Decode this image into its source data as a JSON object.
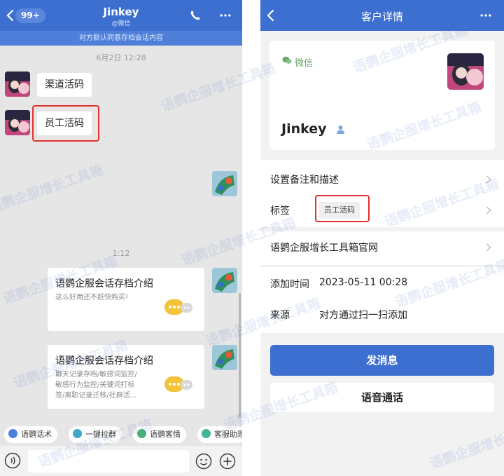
{
  "chat": {
    "unread_badge": "99+",
    "title": "Jinkey",
    "subtitle": "@微信",
    "notice": "对方默认同意存档会话内容",
    "timestamp_1": "6月2日 12:28",
    "msg_1": "渠道活码",
    "msg_2": "员工活码",
    "timestamp_2": "1:12",
    "card_1": {
      "title": "语鹦企服会话存档介绍",
      "desc": "这么好用还不赶快购买!"
    },
    "card_2": {
      "title": "语鹦企服会话存档介绍",
      "desc_lines": [
        "聊天记录存档/敏感词监控/",
        "敏感行为监控/关键词打标",
        "签/离职记录迁移/社群活..."
      ]
    },
    "quick_actions": [
      {
        "label": "语鹦话术",
        "color": "#4a7fe0"
      },
      {
        "label": "一键拉群",
        "color": "#3fa7c9"
      },
      {
        "label": "语鹦客情",
        "color": "#4bb07a"
      },
      {
        "label": "客服助理",
        "color": "#3fb59a"
      }
    ],
    "icons": [
      "chevron-left-icon",
      "phone-icon",
      "more-icon",
      "voice-icon",
      "emoji-icon",
      "plus-icon"
    ]
  },
  "detail": {
    "header_title": "客户详情",
    "wechat_label": "微信",
    "name": "Jinkey",
    "rows": {
      "remark": "设置备注和描述",
      "tag_label": "标签",
      "tag_value": "员工活码",
      "website": "语鹦企服增长工具箱官网",
      "added_label": "添加时间",
      "added_value": "2023-05-11 00:28",
      "source_label": "来源",
      "source_value": "对方通过扫一扫添加"
    },
    "send_button": "发消息",
    "voice_button": "语音通话",
    "icons": [
      "chevron-left-icon",
      "more-icon",
      "wechat-icon",
      "person-icon",
      "chevron-right-icon"
    ]
  },
  "watermark": "语鹦企服增长工具箱",
  "colors": {
    "brand_blue": "#3d6fd1",
    "highlight_red": "#e0312f",
    "wechat_green": "#6aa56a"
  }
}
